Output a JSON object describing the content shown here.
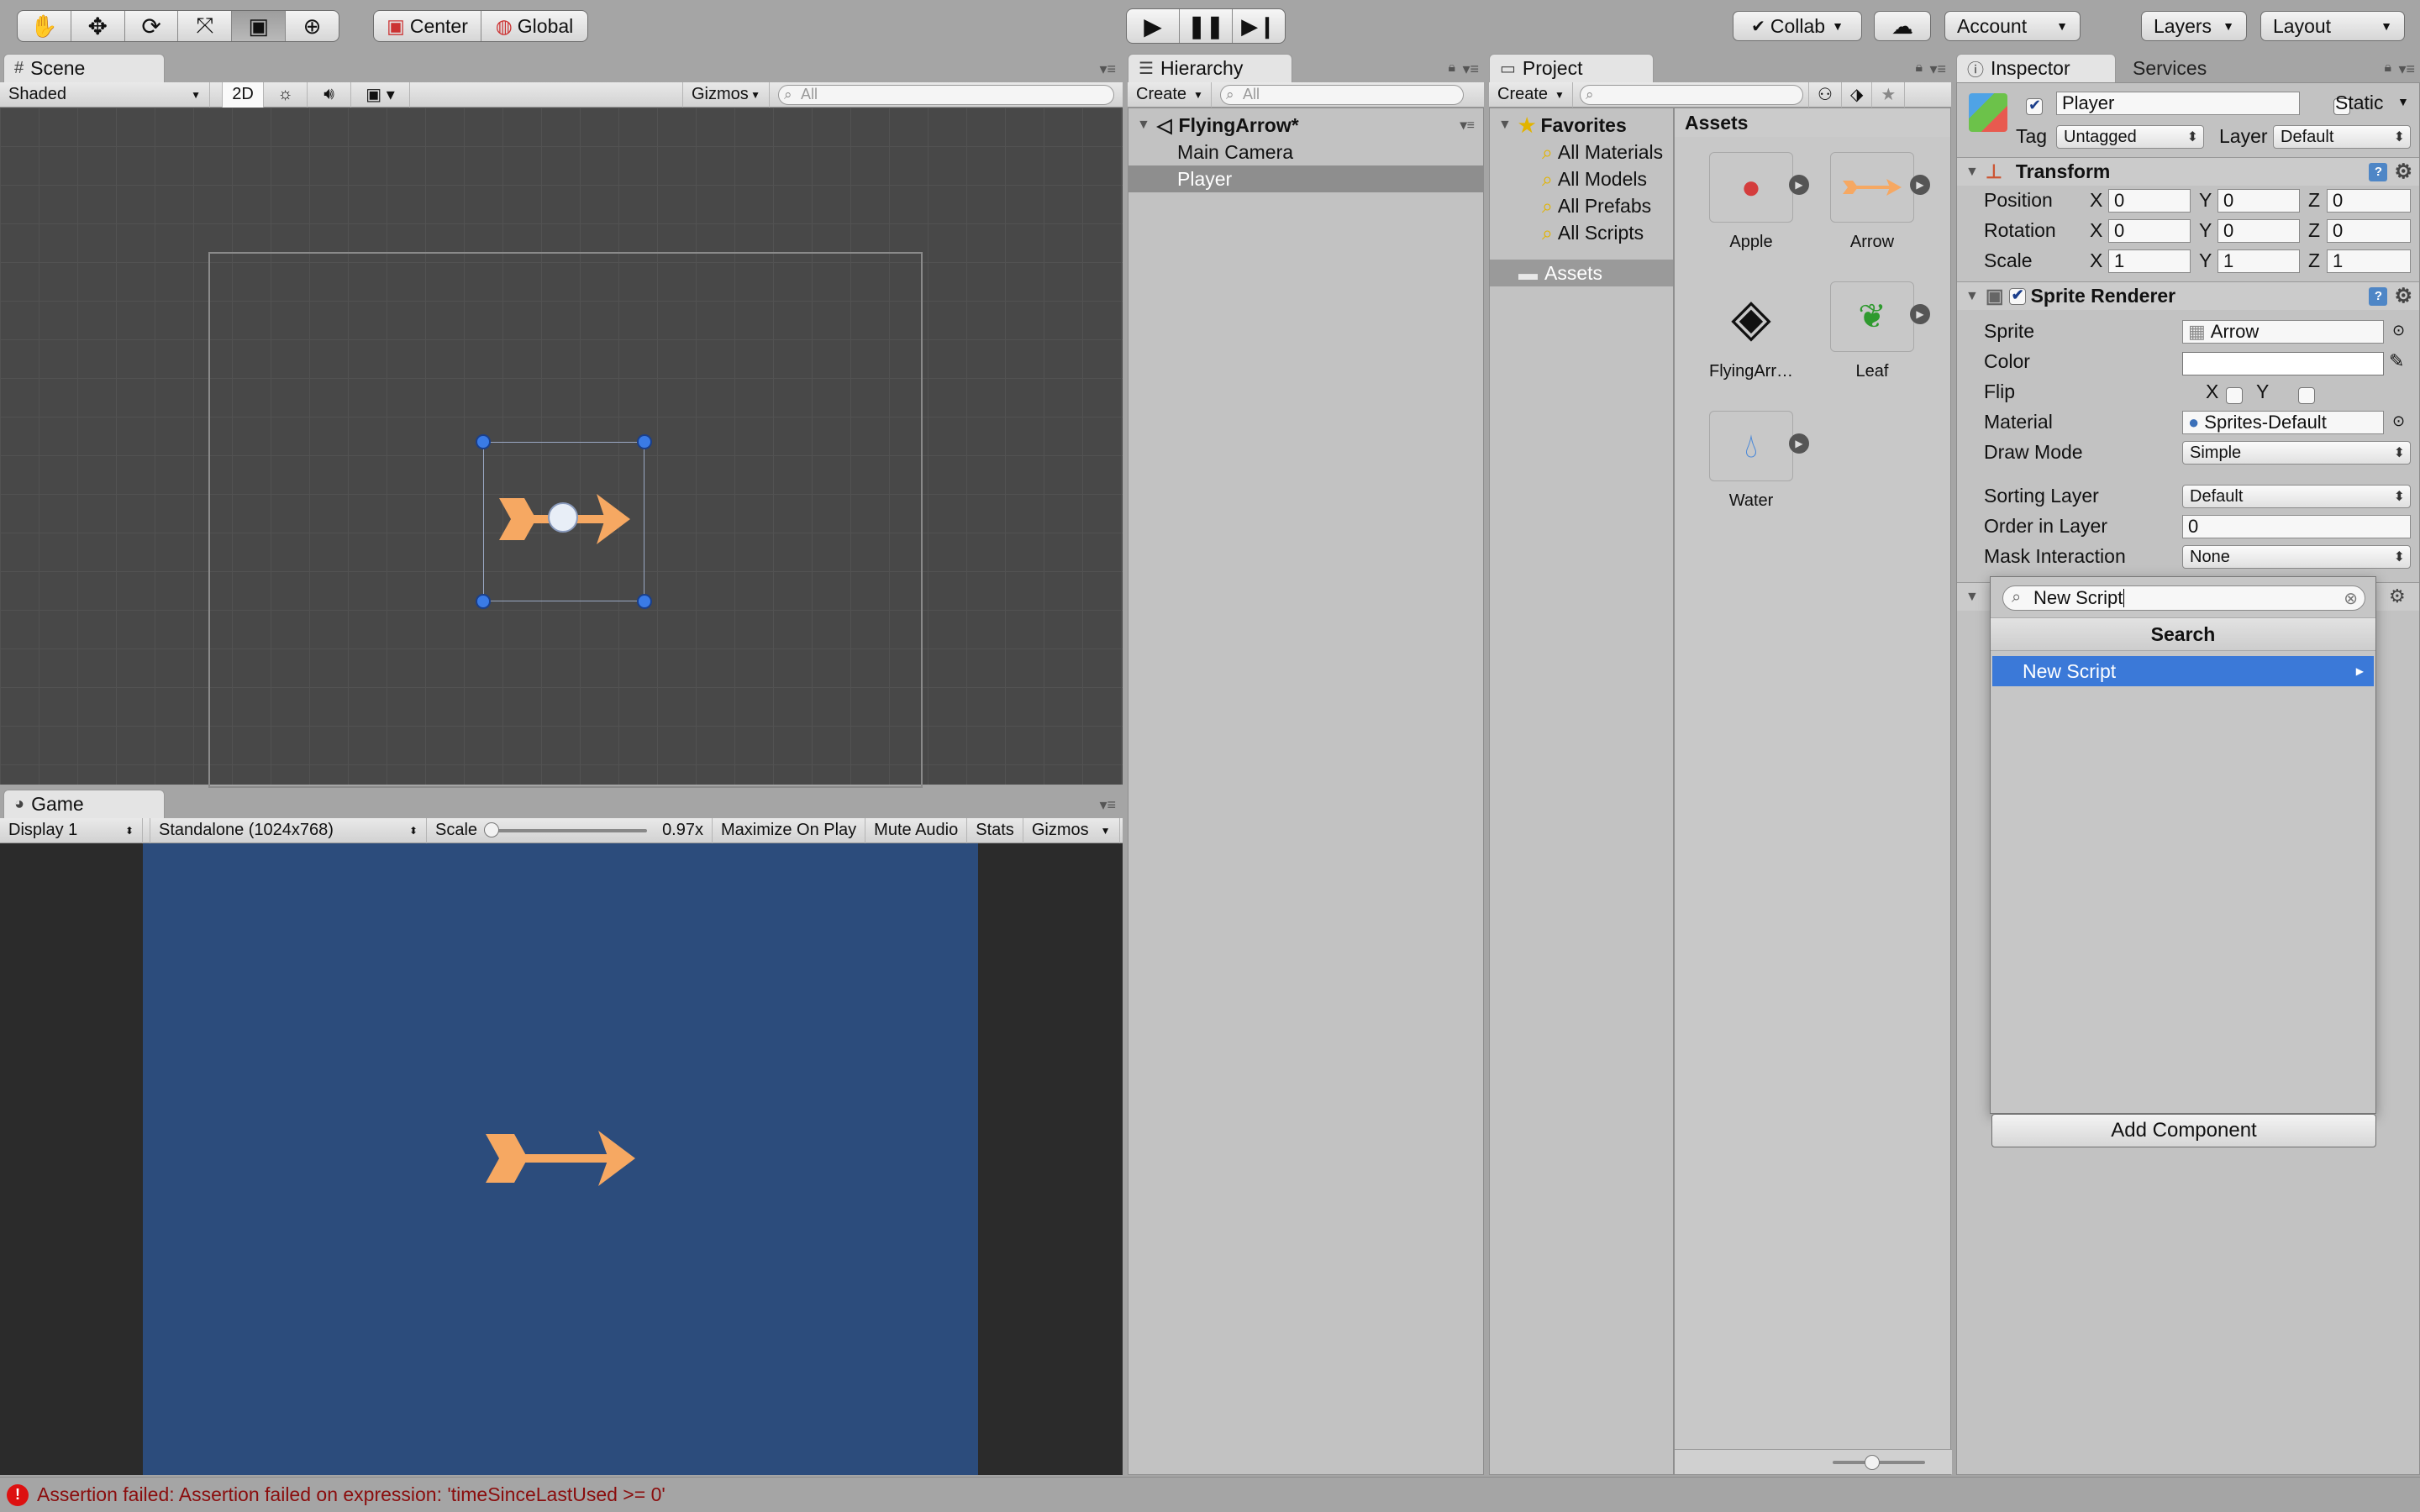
{
  "toolbar": {
    "tools": [
      "hand-tool",
      "move-tool",
      "rotate-tool",
      "scale-tool",
      "rect-tool",
      "transform-tool"
    ],
    "pivot_center": "Center",
    "pivot_global": "Global",
    "collab": "Collab",
    "account": "Account",
    "layers": "Layers",
    "layout": "Layout"
  },
  "scene": {
    "tab": "Scene",
    "shading": "Shaded",
    "mode_2d": "2D",
    "gizmos": "Gizmos",
    "search_placeholder": "All"
  },
  "game": {
    "tab": "Game",
    "display": "Display 1",
    "resolution": "Standalone (1024x768)",
    "scale_label": "Scale",
    "scale_value": "0.97x",
    "maximize": "Maximize On Play",
    "mute": "Mute Audio",
    "stats": "Stats",
    "gizmos": "Gizmos",
    "background_color": "#2c4c7c",
    "arrow_color": "#f6a862"
  },
  "hierarchy": {
    "tab": "Hierarchy",
    "create": "Create",
    "search_placeholder": "All",
    "scene_name": "FlyingArrow*",
    "items": [
      "Main Camera",
      "Player"
    ]
  },
  "project": {
    "tab": "Project",
    "create": "Create",
    "favorites_label": "Favorites",
    "favorites": [
      "All Materials",
      "All Models",
      "All Prefabs",
      "All Scripts"
    ],
    "assets_folder": "Assets",
    "assets_header": "Assets",
    "assets": [
      "Apple",
      "Arrow",
      "FlyingArr…",
      "Leaf",
      "Water"
    ]
  },
  "inspector": {
    "tab": "Inspector",
    "tab_services": "Services",
    "object_name": "Player",
    "static_label": "Static",
    "tag_label": "Tag",
    "tag_value": "Untagged",
    "layer_label": "Layer",
    "layer_value": "Default",
    "transform": {
      "title": "Transform",
      "position_label": "Position",
      "rotation_label": "Rotation",
      "scale_label": "Scale",
      "position": [
        "0",
        "0",
        "0"
      ],
      "rotation": [
        "0",
        "0",
        "0"
      ],
      "scale": [
        "1",
        "1",
        "1"
      ]
    },
    "sprite_renderer": {
      "title": "Sprite Renderer",
      "sprite_label": "Sprite",
      "sprite_value": "Arrow",
      "color_label": "Color",
      "flip_label": "Flip",
      "flip_x": "X",
      "flip_y": "Y",
      "material_label": "Material",
      "material_value": "Sprites-Default",
      "draw_mode_label": "Draw Mode",
      "draw_mode_value": "Simple",
      "sorting_layer_label": "Sorting Layer",
      "sorting_layer_value": "Default",
      "order_label": "Order in Layer",
      "order_value": "0",
      "mask_label": "Mask Interaction",
      "mask_value": "None"
    },
    "popup": {
      "search_value": "New Script",
      "header": "Search",
      "item": "New Script"
    },
    "add_component": "Add Component"
  },
  "status": {
    "message": "Assertion failed: Assertion failed on expression: 'timeSinceLastUsed >= 0'"
  }
}
